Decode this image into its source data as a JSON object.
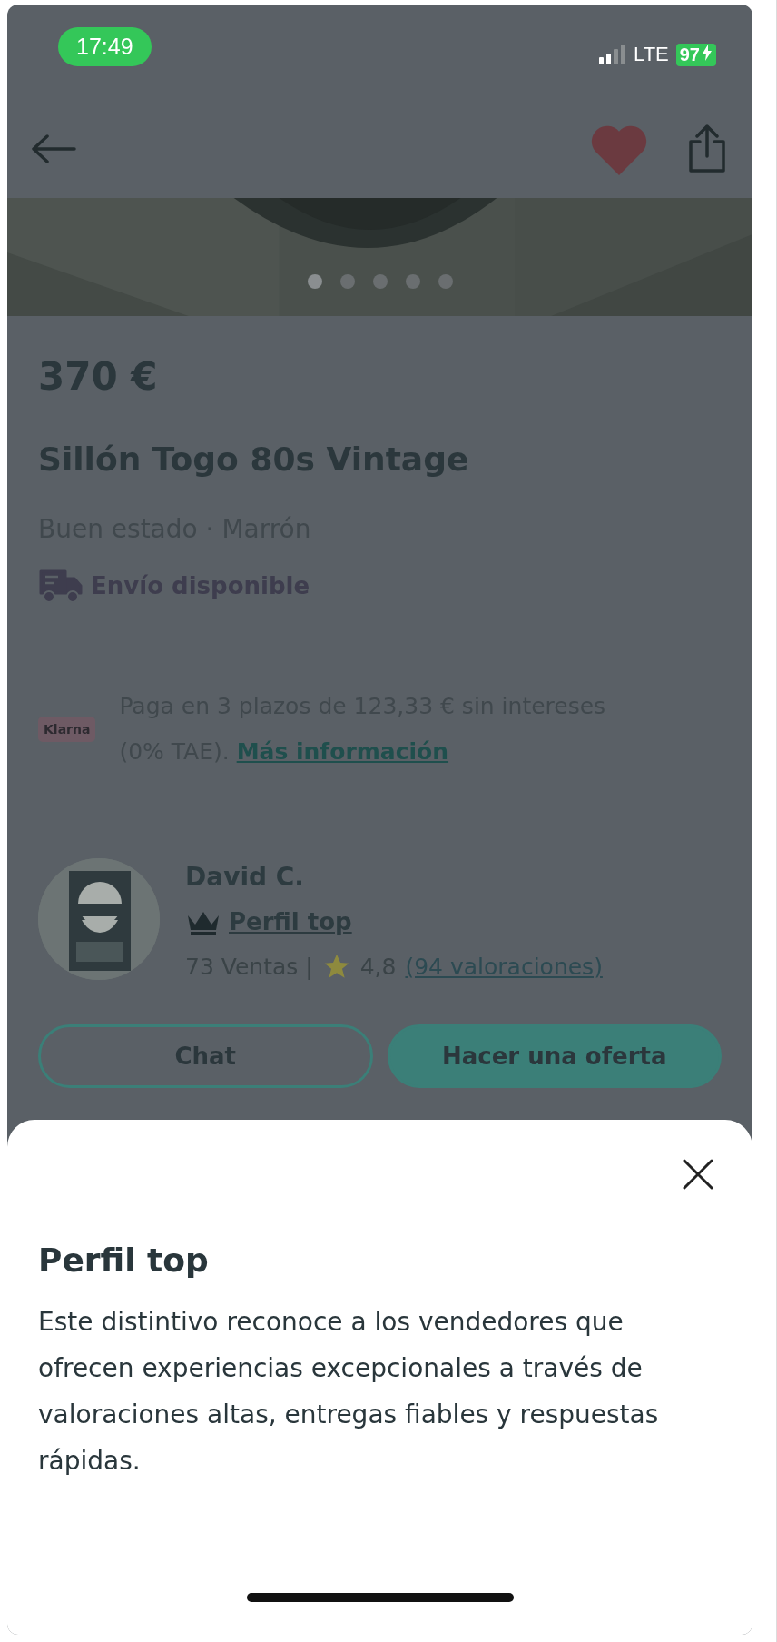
{
  "status_bar": {
    "time": "17:49",
    "network": "LTE",
    "battery": "97"
  },
  "nav": {
    "favorited": true
  },
  "carousel": {
    "dots": [
      {
        "selected": true
      },
      {
        "selected": false
      },
      {
        "selected": false
      },
      {
        "selected": false
      },
      {
        "selected": false
      }
    ]
  },
  "product": {
    "price": "370 €",
    "title": "Sillón Togo 80s Vintage",
    "details": "Buen estado · Marrón",
    "shipping": "Envío disponible"
  },
  "financing": {
    "badge": "Klarna",
    "text": "Paga en 3 plazos de 123,33 € sin intereses (0% TAE).",
    "link": "Más información"
  },
  "seller": {
    "name": "David C.",
    "badge": "Perfil top",
    "sales": "73 Ventas |",
    "rating": "4,8",
    "reviews": "(94 valoraciones)"
  },
  "buttons": [
    {
      "label": "Chat",
      "kind": "outline"
    },
    {
      "label": "Hacer una oferta",
      "kind": "filled"
    }
  ],
  "sheet": {
    "title": "Perfil top",
    "body": "Este distintivo reconoce a los vendedores que ofrecen experiencias excepcionales a través de valoraciones altas, entregas fiables y respuestas rápidas."
  }
}
